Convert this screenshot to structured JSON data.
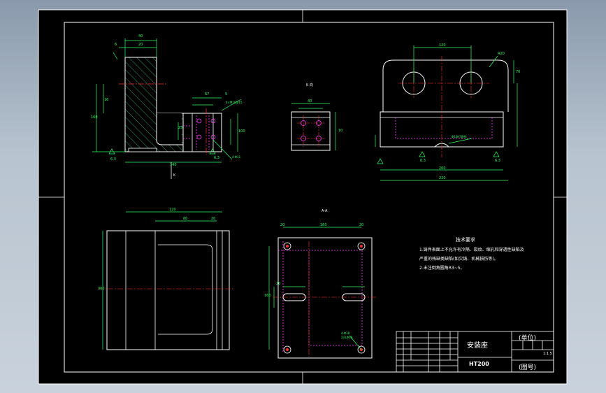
{
  "drawing": {
    "title_block": {
      "part_name": "安装座",
      "unit_label": "(单位)",
      "drawing_no_label": "(图号)",
      "material": "HT200",
      "scale": "1:1.5"
    },
    "tech_requirements": {
      "heading": "技术要求",
      "items": [
        "1.铸件表面上不允许有冷隔、裂纹、缩孔和穿透性缺陷及",
        "严重的残缺类缺陷(如欠铸、机械损伤等)。",
        "2.未注倒角圆角R3~5。"
      ]
    },
    "view_labels": {
      "k_view": "K 向",
      "section": "A-A",
      "mark_k": "K"
    },
    "dims": {
      "top_width": "40",
      "top_left": "6",
      "top_mid": "20",
      "side_height": "160",
      "side_small": "16",
      "total_height": "100",
      "foot_h": "25",
      "foot_w": "67",
      "foot_gap": "5",
      "hole_note": "4×M10深15",
      "foot_note": "4-Φ11",
      "bottom_width": "140",
      "rough_val": "6.3",
      "kv_w": "40",
      "kv_h": "10",
      "front_top": "120",
      "front_r": "R20",
      "front_h": "70",
      "front_bot_w": "200",
      "front_total": "220",
      "front_note": "Φ10H7配作",
      "bl_top": "120",
      "bl_mid": "60",
      "bl_right": "20",
      "bl_h": "300",
      "br_top": "160",
      "br_left": "20",
      "br_right": "20",
      "br_h": "160",
      "br_mid": "20",
      "br_note": "4-Φ18",
      "br_note2": "沉孔Φ28"
    }
  }
}
